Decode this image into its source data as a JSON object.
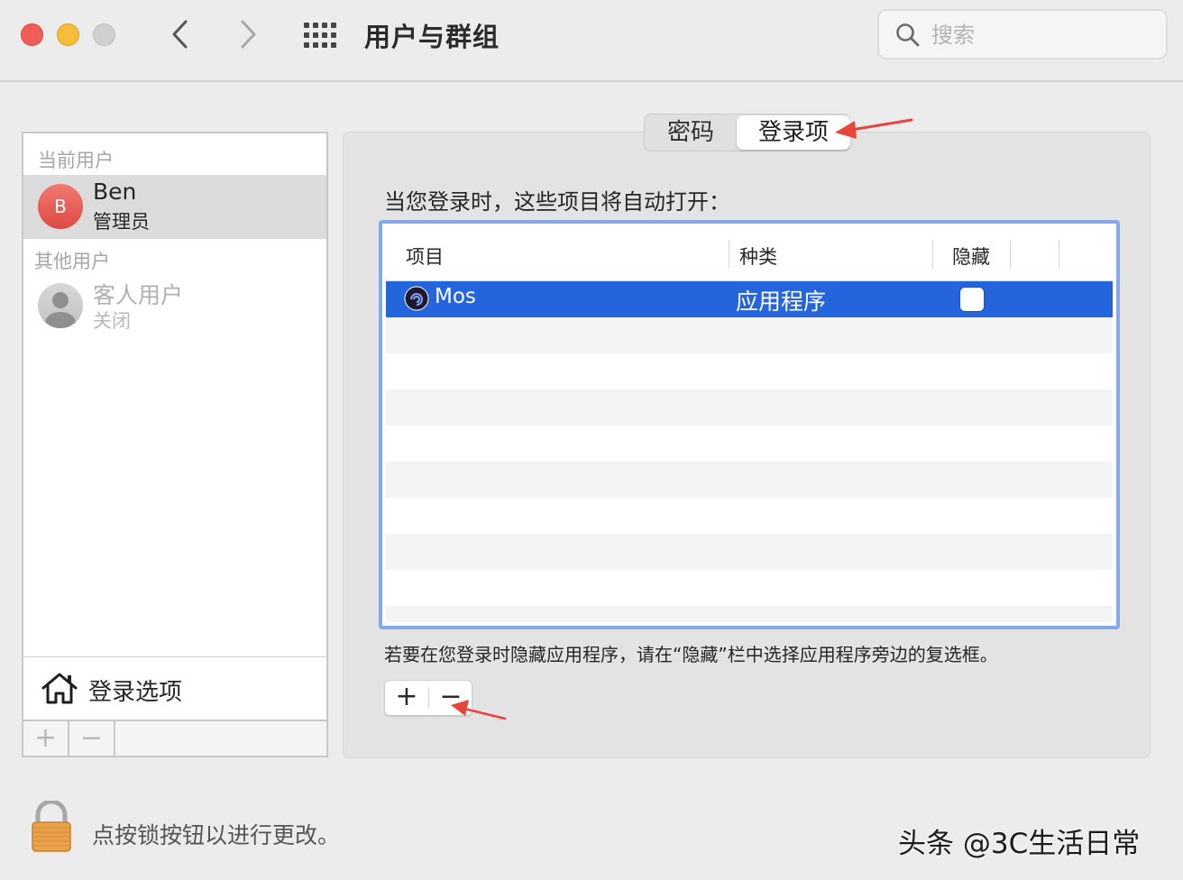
{
  "window": {
    "title": "用户与群组",
    "search_placeholder": "搜索"
  },
  "icons": {
    "back": "chevron-left-icon",
    "forward": "chevron-right-icon",
    "show_all": "grid-icon",
    "search": "search-icon",
    "home": "house-icon",
    "lock": "lock-icon"
  },
  "users_panel": {
    "current_header": "当前用户",
    "current_user": {
      "avatar_letter": "B",
      "name": "Ben",
      "role": "管理员"
    },
    "other_header": "其他用户",
    "guest_user": {
      "name": "客人用户",
      "status": "关闭"
    },
    "login_options_label": "登录选项",
    "add_label": "+",
    "remove_label": "−"
  },
  "tabs": [
    {
      "label": "密码",
      "selected": false
    },
    {
      "label": "登录项",
      "selected": true
    }
  ],
  "login_items": {
    "intro": "当您登录时，这些项目将自动打开：",
    "columns": [
      "项目",
      "种类",
      "隐藏"
    ],
    "rows": [
      {
        "name": "Mos",
        "type": "应用程序",
        "hidden": false,
        "selected": true
      }
    ],
    "hint": "若要在您登录时隐藏应用程序，请在“隐藏”栏中选择应用程序旁边的复选框。",
    "add_label": "+",
    "remove_label": "−"
  },
  "footer": {
    "lock_text": "点按锁按钮以进行更改。",
    "watermark": "头条 @3C生活日常"
  },
  "colors": {
    "selection": "#2464dd",
    "focus_ring": "#84a8e9",
    "annotation_arrow": "#e8453c",
    "avatar": "#e8574f"
  }
}
